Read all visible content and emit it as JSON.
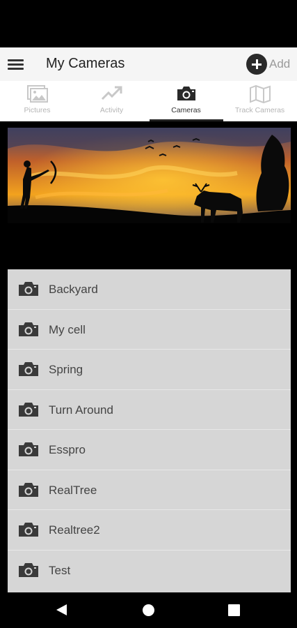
{
  "header": {
    "title": "My Cameras",
    "add_label": "Add",
    "menu_icon": "hamburger-menu-icon",
    "add_icon": "plus-circle-icon"
  },
  "tabs": [
    {
      "label": "Pictures",
      "icon": "image-gallery-icon",
      "active": false
    },
    {
      "label": "Activity",
      "icon": "trending-up-icon",
      "active": false
    },
    {
      "label": "Cameras",
      "icon": "camera-icon",
      "active": true
    },
    {
      "label": "Track Cameras",
      "icon": "map-icon",
      "active": false
    }
  ],
  "banner": {
    "description_icon": "hunting-sunset-banner-image"
  },
  "cameras": [
    {
      "name": "Backyard"
    },
    {
      "name": "My cell"
    },
    {
      "name": "Spring"
    },
    {
      "name": "Turn Around"
    },
    {
      "name": "Esspro"
    },
    {
      "name": "RealTree"
    },
    {
      "name": "Realtree2"
    },
    {
      "name": "Test"
    }
  ],
  "colors": {
    "app_bar_bg": "#f5f5f5",
    "list_bg": "#d6d6d6",
    "active_indicator": "#222222",
    "inactive_tab": "#b5b5b5"
  }
}
